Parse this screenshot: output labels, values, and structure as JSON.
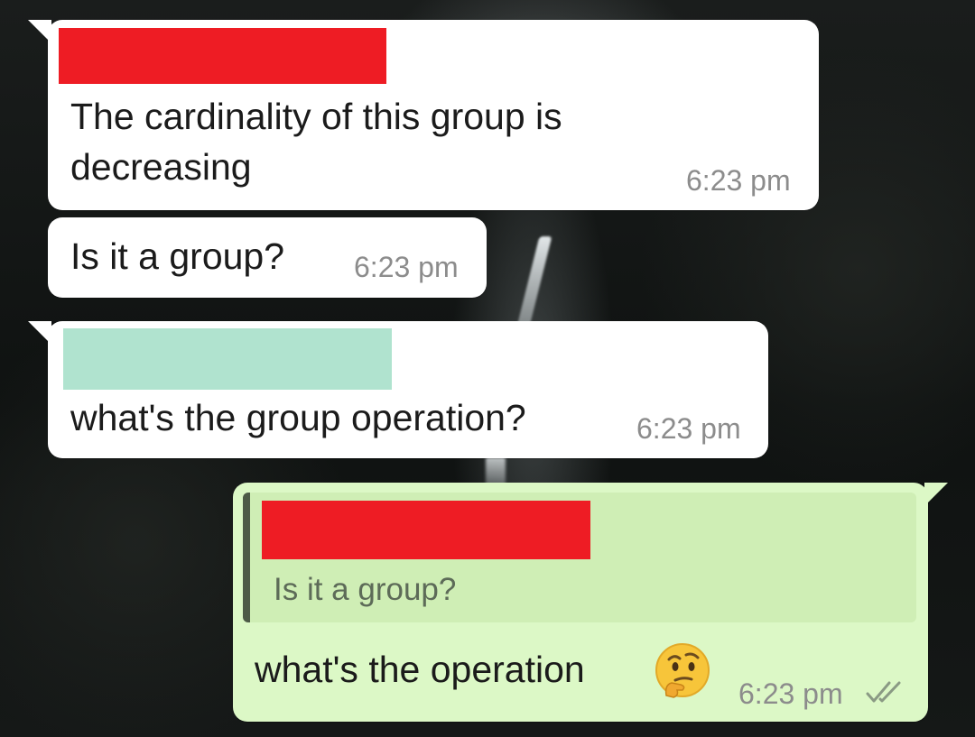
{
  "messages": [
    {
      "direction": "incoming",
      "text_lines": [
        "The cardinality of this group is",
        "decreasing"
      ],
      "time": "6:23 pm",
      "sender_redaction_color": "#ee1c24"
    },
    {
      "direction": "incoming",
      "text": "Is it a group?",
      "time": "6:23 pm"
    },
    {
      "direction": "incoming",
      "text": "what's the group operation?",
      "time": "6:23 pm",
      "sender_redaction_color": "#b0e3cf"
    },
    {
      "direction": "outgoing",
      "quoted": {
        "sender_redaction_color": "#ee1c24",
        "text": "Is it a group?"
      },
      "text": "what's the operation",
      "emoji": "thinking-face-emoji",
      "time": "6:23 pm",
      "status": "read-double-check-icon"
    }
  ],
  "colors": {
    "incoming_bubble": "#ffffff",
    "outgoing_bubble": "#dcf8c6",
    "quote_bar": "#4d5a47",
    "timestamp": "#8c8c8c",
    "read_ticks": "#8a9a84"
  }
}
